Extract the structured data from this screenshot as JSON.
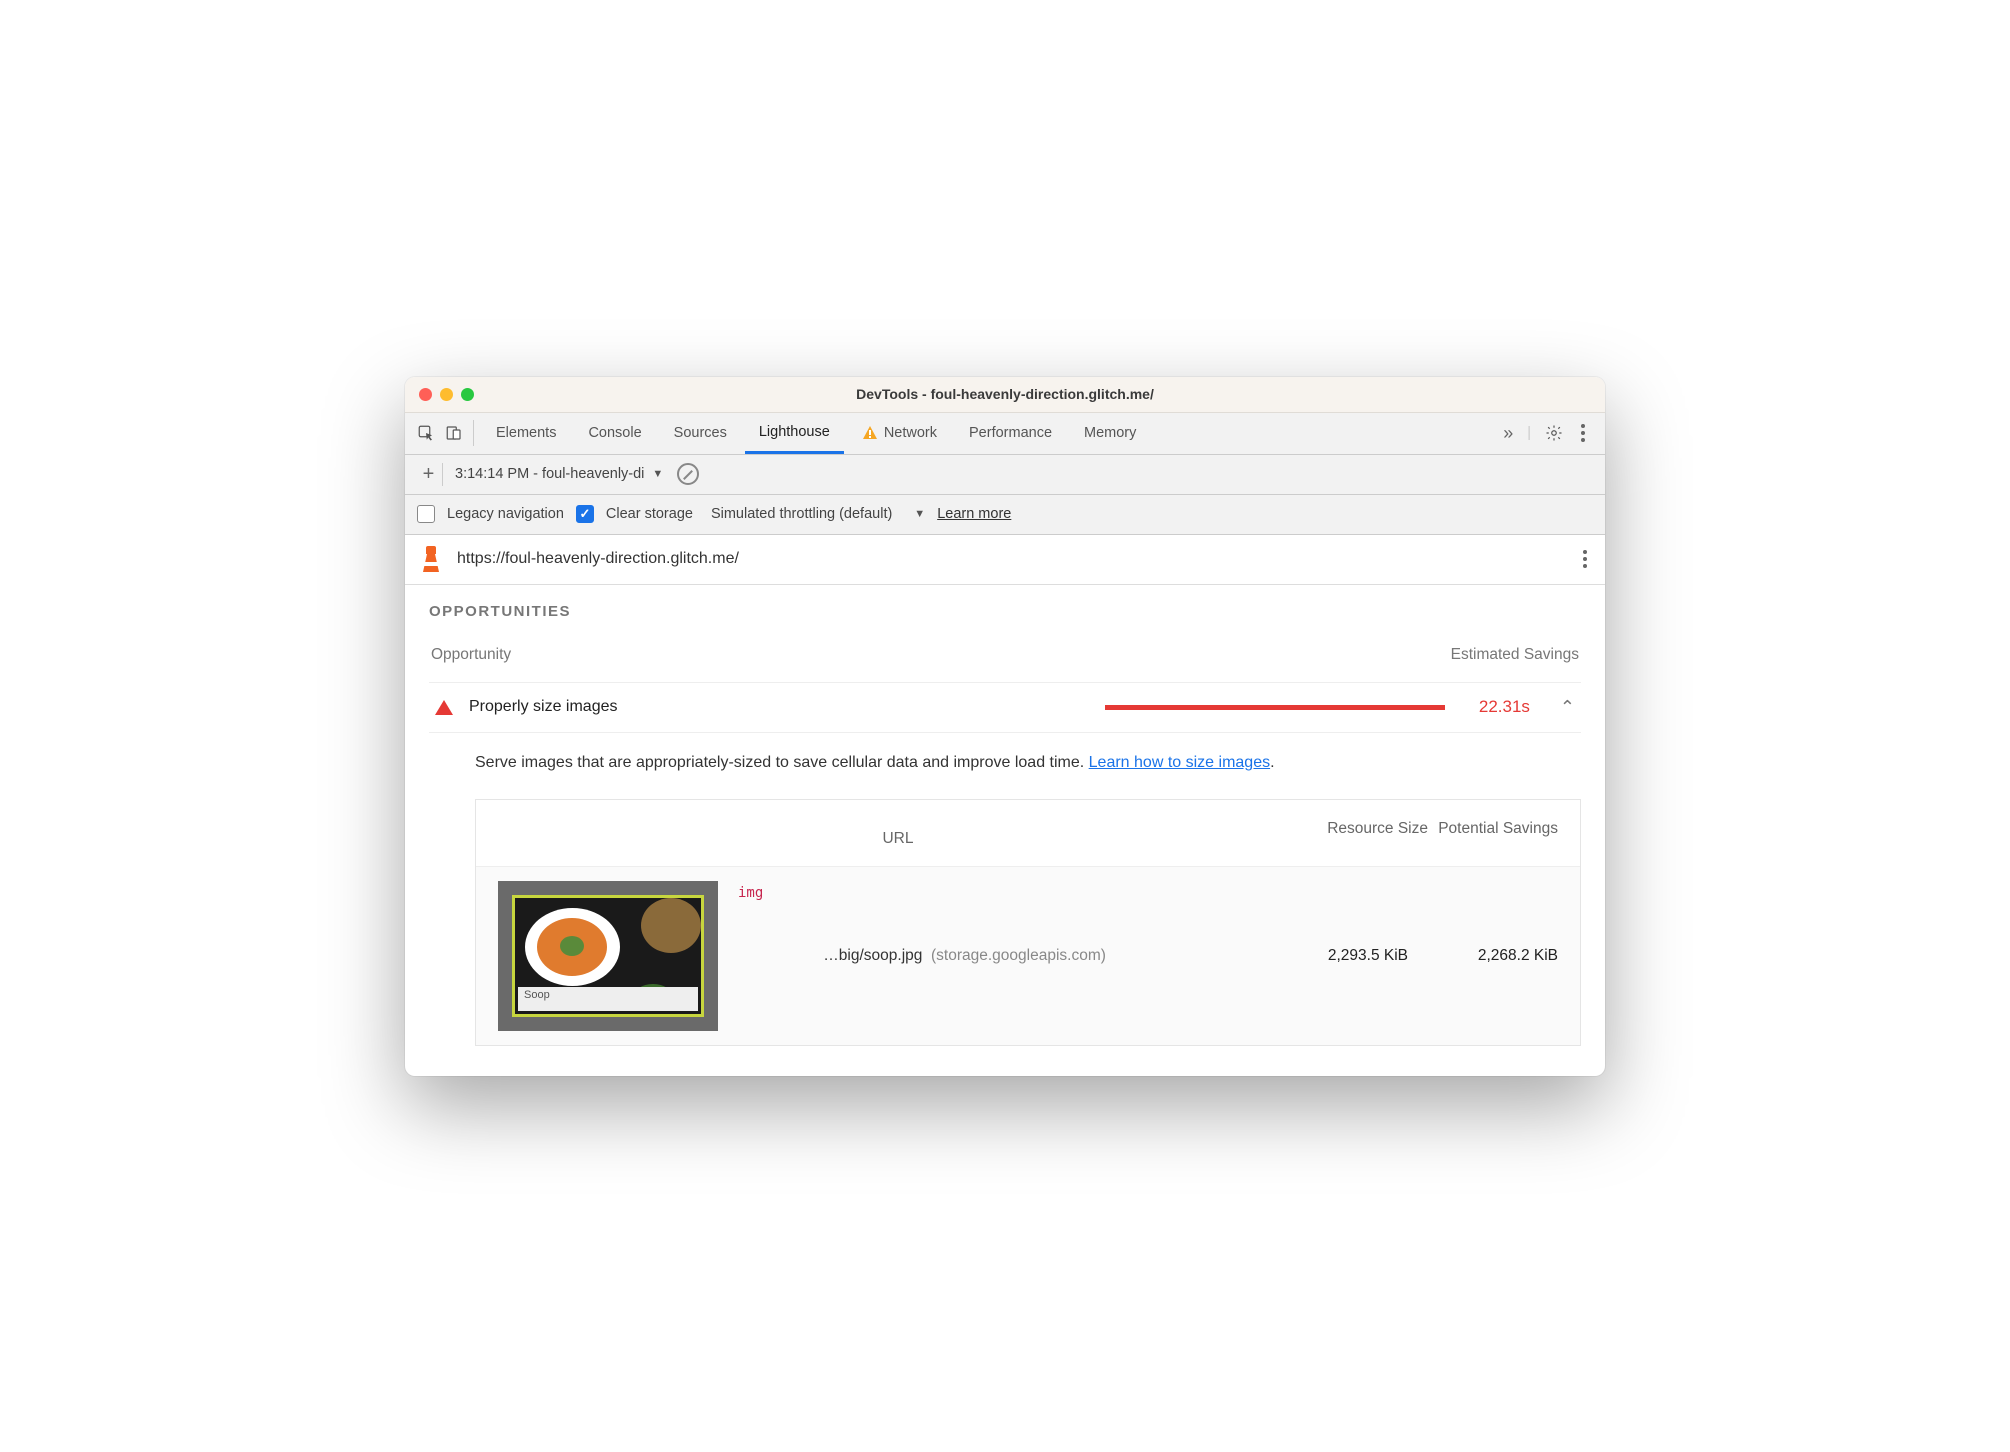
{
  "window": {
    "title": "DevTools - foul-heavenly-direction.glitch.me/"
  },
  "tabs": {
    "items": [
      "Elements",
      "Console",
      "Sources",
      "Lighthouse",
      "Network",
      "Performance",
      "Memory"
    ],
    "active": "Lighthouse",
    "network_warning": true
  },
  "subbar": {
    "run_label": "3:14:14 PM - foul-heavenly-di"
  },
  "options": {
    "legacy_nav": {
      "label": "Legacy navigation",
      "checked": false
    },
    "clear_storage": {
      "label": "Clear storage",
      "checked": true
    },
    "throttling": "Simulated throttling (default)",
    "learn_more": "Learn more"
  },
  "urlbar": {
    "url": "https://foul-heavenly-direction.glitch.me/"
  },
  "section": {
    "title": "OPPORTUNITIES",
    "col_opportunity": "Opportunity",
    "col_savings": "Estimated Savings"
  },
  "opportunity": {
    "name": "Properly size images",
    "savings": "22.31s",
    "description": "Serve images that are appropriately-sized to save cellular data and improve load time. ",
    "learn_link": "Learn how to size images",
    "period": "."
  },
  "table": {
    "headers": {
      "url": "URL",
      "size": "Resource Size",
      "potential": "Potential Savings"
    },
    "row": {
      "tag": "img",
      "path": "…big/soop.jpg",
      "host": "(storage.googleapis.com)",
      "size": "2,293.5 KiB",
      "potential": "2,268.2 KiB",
      "thumb_caption": "Soop"
    }
  }
}
